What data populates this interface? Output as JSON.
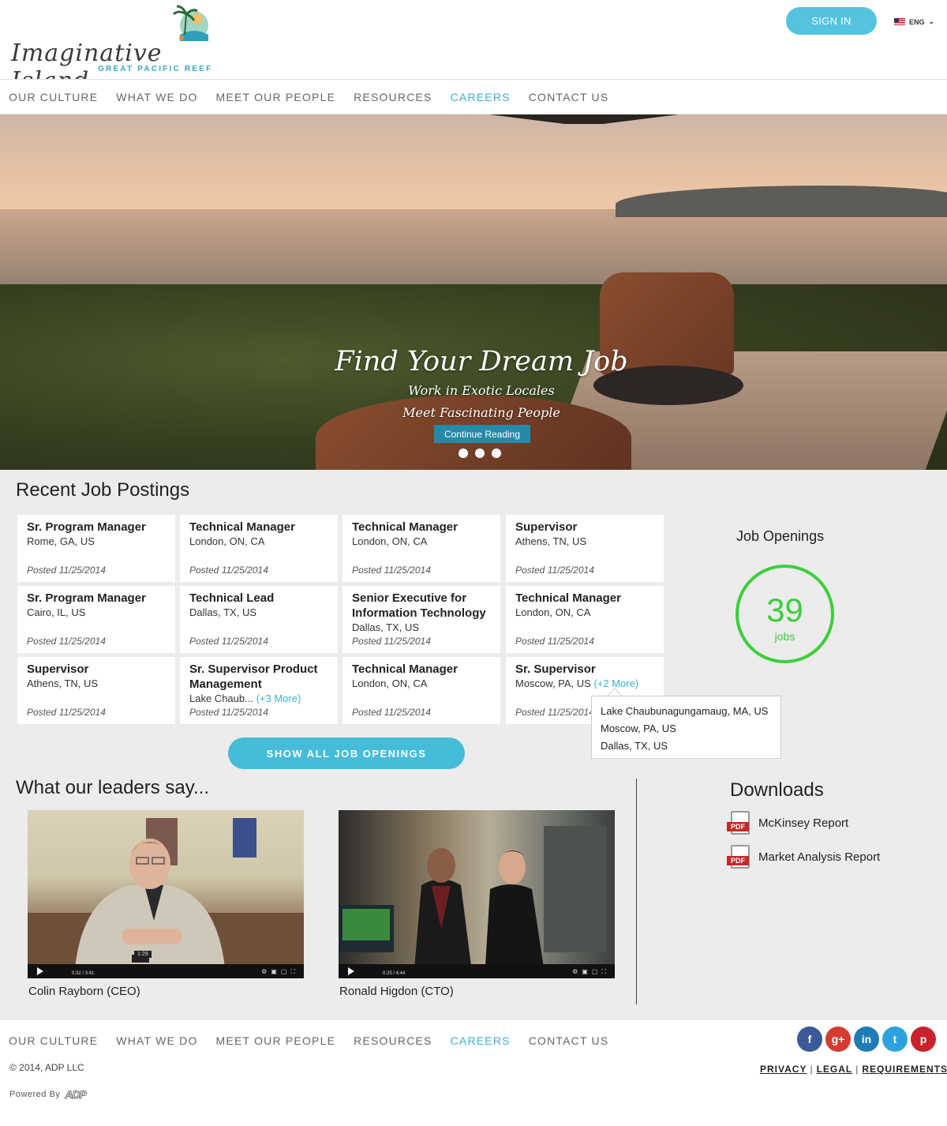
{
  "header": {
    "logo_text": "Imaginative Island",
    "logo_sub": "GREAT PACIFIC REEF",
    "signin_label": "SIGN IN",
    "language": "ENG"
  },
  "nav": {
    "items": [
      "OUR CULTURE",
      "WHAT WE DO",
      "MEET OUR PEOPLE",
      "RESOURCES",
      "CAREERS",
      "CONTACT US"
    ],
    "active": "CAREERS"
  },
  "hero": {
    "title": "Find Your Dream Job",
    "line1": "Work in Exotic Locales",
    "line2": "Meet Fascinating People",
    "button": "Continue Reading",
    "slide_count": 3
  },
  "jobs": {
    "title": "Recent Job Postings",
    "cards": [
      {
        "title": "Sr. Program Manager",
        "location": "Rome, GA, US",
        "more": "",
        "posted": "Posted 11/25/2014"
      },
      {
        "title": "Technical Manager",
        "location": "London, ON, CA",
        "more": "",
        "posted": "Posted 11/25/2014"
      },
      {
        "title": "Technical Manager",
        "location": "London, ON, CA",
        "more": "",
        "posted": "Posted 11/25/2014"
      },
      {
        "title": "Supervisor",
        "location": "Athens, TN, US",
        "more": "",
        "posted": "Posted 11/25/2014"
      },
      {
        "title": "Sr. Program Manager",
        "location": "Cairo, IL, US",
        "more": "",
        "posted": "Posted 11/25/2014"
      },
      {
        "title": "Technical Lead",
        "location": "Dallas, TX, US",
        "more": "",
        "posted": "Posted 11/25/2014"
      },
      {
        "title": "Senior Executive for Information Technology",
        "location": "Dallas, TX, US",
        "more": "",
        "posted": "Posted 11/25/2014"
      },
      {
        "title": "Technical Manager",
        "location": "London, ON, CA",
        "more": "",
        "posted": "Posted 11/25/2014"
      },
      {
        "title": "Supervisor",
        "location": "Athens, TN, US",
        "more": "",
        "posted": "Posted 11/25/2014"
      },
      {
        "title": "Sr. Supervisor Product Management",
        "location": "Lake Chaub...",
        "more": "(+3 More)",
        "posted": "Posted 11/25/2014"
      },
      {
        "title": "Technical Manager",
        "location": "London, ON, CA",
        "more": "",
        "posted": "Posted 11/25/2014"
      },
      {
        "title": "Sr. Supervisor",
        "location": "Moscow, PA, US",
        "more": "(+2 More)",
        "posted": "Posted 11/25/2014"
      }
    ],
    "tooltip": [
      "Lake Chaubunagungamaug, MA, US",
      "Moscow, PA, US",
      "Dallas, TX, US"
    ],
    "show_all": "SHOW ALL JOB OPENINGS"
  },
  "openings": {
    "title": "Job Openings",
    "count": "39",
    "unit": "jobs"
  },
  "leaders": {
    "title": "What our leaders say...",
    "videos": [
      {
        "caption": "Colin Rayborn (CEO)",
        "time": "0:32 / 3:41",
        "hover_time": "1:29",
        "progress": 0.155
      },
      {
        "caption": "Ronald Higdon (CTO)",
        "time": "0:25 / 4:44",
        "hover_time": "",
        "progress": 0.09
      }
    ]
  },
  "downloads": {
    "title": "Downloads",
    "items": [
      "McKinsey Report",
      "Market Analysis Report"
    ],
    "badge": "PDF"
  },
  "footer": {
    "copyright": "© 2014, ADP LLC",
    "links": [
      "PRIVACY",
      "LEGAL",
      "REQUIREMENTS"
    ],
    "powered": "Powered By",
    "powered_logo": "ADP",
    "socials": [
      {
        "name": "facebook",
        "glyph": "f",
        "color": "#3b5998"
      },
      {
        "name": "google-plus",
        "glyph": "g+",
        "color": "#d63b2f"
      },
      {
        "name": "linkedin",
        "glyph": "in",
        "color": "#1f7bb6"
      },
      {
        "name": "twitter",
        "glyph": "t",
        "color": "#2ea2de"
      },
      {
        "name": "pinterest",
        "glyph": "p",
        "color": "#c9222a"
      }
    ]
  },
  "colors": {
    "accent": "#3ab0cf",
    "button": "#45bcd9",
    "ring": "#3ccf3a"
  }
}
